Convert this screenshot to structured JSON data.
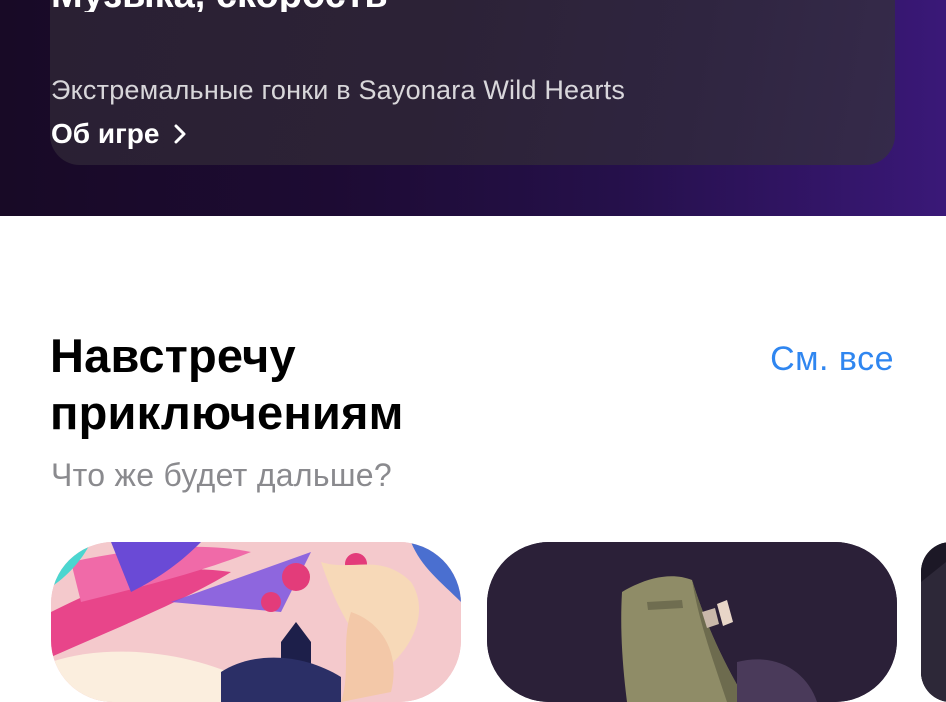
{
  "hero": {
    "title": "Музыка, скорость",
    "subtitle": "Экстремальные гонки в Sayonara Wild Hearts",
    "link_label": "Об игре"
  },
  "section": {
    "title": "Навстречу приключениям",
    "see_all_label": "См. все",
    "subtitle": "Что же будет дальше?"
  },
  "colors": {
    "accent": "#2f86f0",
    "hero_background": "#1d0b33",
    "secondary_text": "#8a8a8e"
  },
  "tiles": [
    {
      "icon": "game-artwork-pink"
    },
    {
      "icon": "game-artwork-witch-hat"
    },
    {
      "icon": "game-artwork-dark"
    }
  ]
}
